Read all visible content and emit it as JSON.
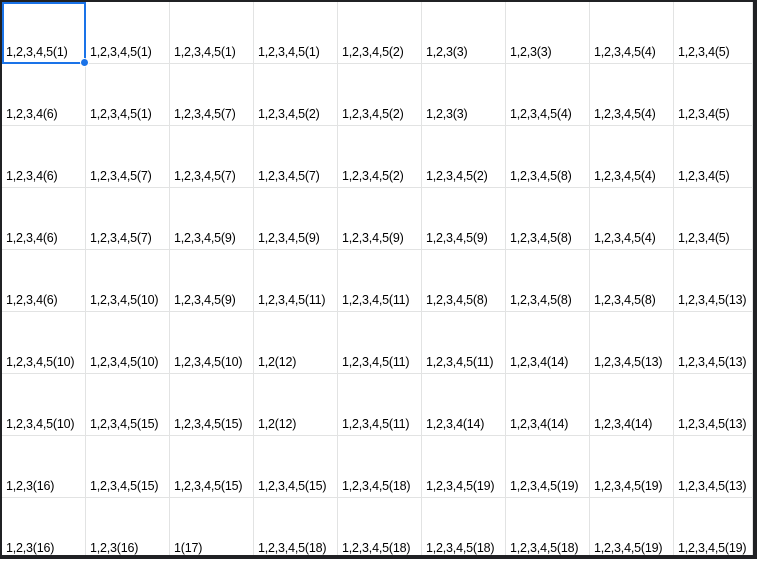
{
  "sheet": {
    "active_cell": {
      "row": 0,
      "col": 0
    },
    "accent_color": "#1a73e8",
    "rows": [
      [
        "1,2,3,4,5(1)",
        "1,2,3,4,5(1)",
        "1,2,3,4,5(1)",
        "1,2,3,4,5(1)",
        "1,2,3,4,5(2)",
        "1,2,3(3)",
        "1,2,3(3)",
        "1,2,3,4,5(4)",
        "1,2,3,4(5)"
      ],
      [
        "1,2,3,4(6)",
        "1,2,3,4,5(1)",
        "1,2,3,4,5(7)",
        "1,2,3,4,5(2)",
        "1,2,3,4,5(2)",
        "1,2,3(3)",
        "1,2,3,4,5(4)",
        "1,2,3,4,5(4)",
        "1,2,3,4(5)"
      ],
      [
        "1,2,3,4(6)",
        "1,2,3,4,5(7)",
        "1,2,3,4,5(7)",
        "1,2,3,4,5(7)",
        "1,2,3,4,5(2)",
        "1,2,3,4,5(2)",
        "1,2,3,4,5(8)",
        "1,2,3,4,5(4)",
        "1,2,3,4(5)"
      ],
      [
        "1,2,3,4(6)",
        "1,2,3,4,5(7)",
        "1,2,3,4,5(9)",
        "1,2,3,4,5(9)",
        "1,2,3,4,5(9)",
        "1,2,3,4,5(9)",
        "1,2,3,4,5(8)",
        "1,2,3,4,5(4)",
        "1,2,3,4(5)"
      ],
      [
        "1,2,3,4(6)",
        "1,2,3,4,5(10)",
        "1,2,3,4,5(9)",
        "1,2,3,4,5(11)",
        "1,2,3,4,5(11)",
        "1,2,3,4,5(8)",
        "1,2,3,4,5(8)",
        "1,2,3,4,5(8)",
        "1,2,3,4,5(13)"
      ],
      [
        "1,2,3,4,5(10)",
        "1,2,3,4,5(10)",
        "1,2,3,4,5(10)",
        "1,2(12)",
        "1,2,3,4,5(11)",
        "1,2,3,4,5(11)",
        "1,2,3,4(14)",
        "1,2,3,4,5(13)",
        "1,2,3,4,5(13)"
      ],
      [
        "1,2,3,4,5(10)",
        "1,2,3,4,5(15)",
        "1,2,3,4,5(15)",
        "1,2(12)",
        "1,2,3,4,5(11)",
        "1,2,3,4(14)",
        "1,2,3,4(14)",
        "1,2,3,4(14)",
        "1,2,3,4,5(13)"
      ],
      [
        "1,2,3(16)",
        "1,2,3,4,5(15)",
        "1,2,3,4,5(15)",
        "1,2,3,4,5(15)",
        "1,2,3,4,5(18)",
        "1,2,3,4,5(19)",
        "1,2,3,4,5(19)",
        "1,2,3,4,5(19)",
        "1,2,3,4,5(13)"
      ],
      [
        "1,2,3(16)",
        "1,2,3(16)",
        "1(17)",
        "1,2,3,4,5(18)",
        "1,2,3,4,5(18)",
        "1,2,3,4,5(18)",
        "1,2,3,4,5(18)",
        "1,2,3,4,5(19)",
        "1,2,3,4,5(19)"
      ]
    ]
  }
}
